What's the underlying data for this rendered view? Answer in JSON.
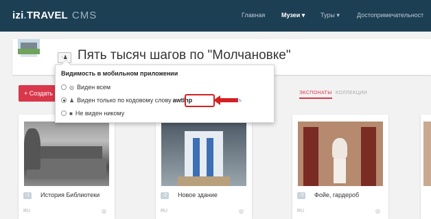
{
  "app": {
    "brand_main": "izi",
    "brand_dot": ".",
    "brand_rest": "TRAVEL",
    "brand_cms": "CMS"
  },
  "nav": {
    "home": "Главная",
    "museums": "Музеи ▾",
    "tours": "Туры ▾",
    "sights": "Достопримечательност"
  },
  "header": {
    "visibility_icon": "person-icon",
    "title": "Пять тысяч шагов по \"Молчановке\""
  },
  "toolbar": {
    "create_label": "+ Создать"
  },
  "tabs": [
    {
      "label": "ЭКСПОНАТЫ",
      "active": true
    },
    {
      "label": "КОЛЛЕКЦИИ",
      "active": false
    }
  ],
  "visibility_popup": {
    "title": "Видимость в мобильном приложении",
    "options": [
      {
        "icon": "globe-icon",
        "label": "Виден всем",
        "selected": false
      },
      {
        "icon": "person-icon",
        "label": "Виден только по кодовому слову",
        "code": "awtlnp",
        "selected": true
      },
      {
        "icon": "lock-icon",
        "label": "Не виден никому",
        "selected": false
      }
    ],
    "tail_text": "ть"
  },
  "exhibits": [
    {
      "number": "1",
      "name": "История Библиотеки",
      "lang": "RU"
    },
    {
      "number": "2",
      "name": "Новое здание",
      "lang": "RU"
    },
    {
      "number": "3",
      "name": "Фойе, гардероб",
      "lang": "RU"
    }
  ],
  "colors": {
    "topbar": "#1d3f54",
    "accent": "#d9374b",
    "highlight": "#d42020"
  }
}
